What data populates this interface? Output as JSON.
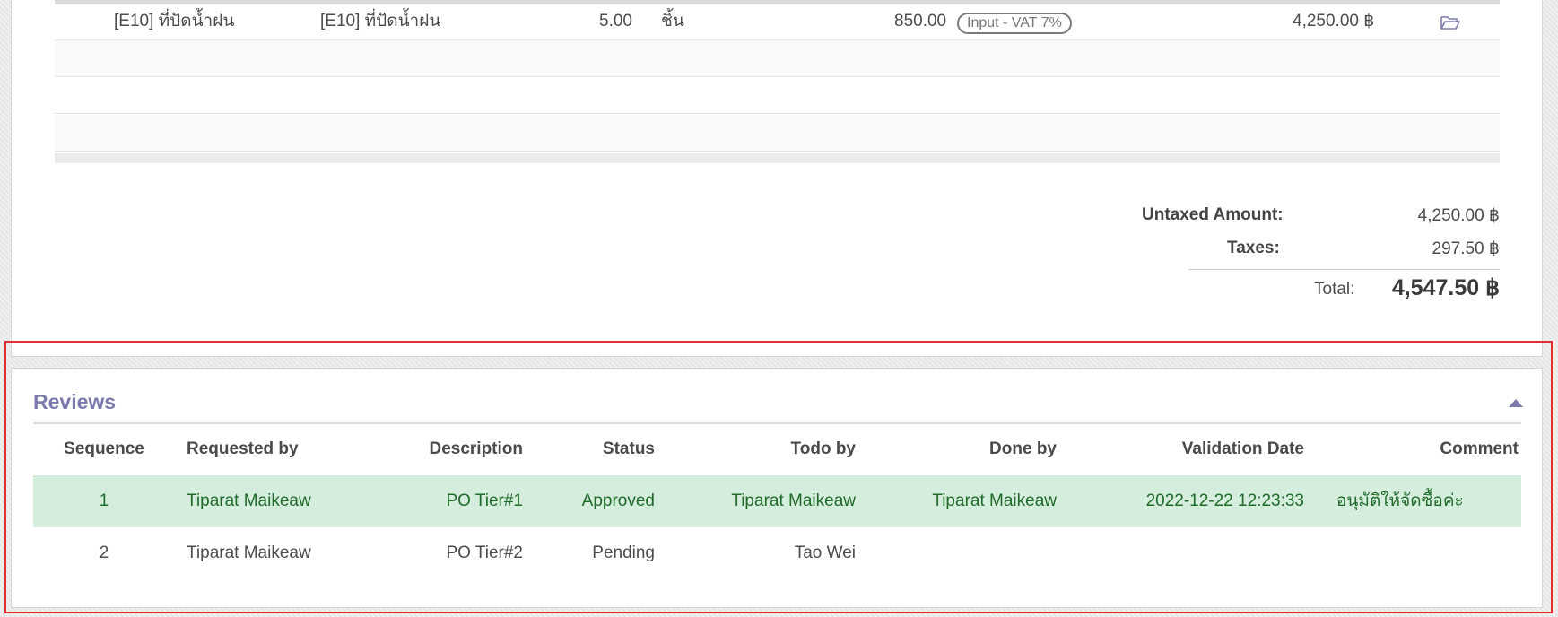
{
  "order_lines": [
    {
      "product": "[E10] ที่ปัดน้ำฝน",
      "description": "[E10] ที่ปัดน้ำฝน",
      "quantity": "5.00",
      "uom": "ชิ้น",
      "unit_price": "850.00",
      "tax": "Input - VAT 7%",
      "subtotal": "4,250.00 ฿"
    }
  ],
  "totals": {
    "untaxed_label": "Untaxed Amount:",
    "untaxed_value": "4,250.00 ฿",
    "taxes_label": "Taxes:",
    "taxes_value": "297.50 ฿",
    "total_label": "Total:",
    "total_value": "4,547.50 ฿"
  },
  "reviews": {
    "title": "Reviews",
    "columns": [
      "Sequence",
      "Requested by",
      "Description",
      "Status",
      "Todo by",
      "Done by",
      "Validation Date",
      "Comment"
    ],
    "rows": [
      {
        "sequence": "1",
        "requested_by": "Tiparat Maikeaw",
        "description": "PO Tier#1",
        "status": "Approved",
        "todo_by": "Tiparat Maikeaw",
        "done_by": "Tiparat Maikeaw",
        "validation_date": "2022-12-22 12:23:33",
        "comment": "อนุมัติให้จัดซื้อค่ะ"
      },
      {
        "sequence": "2",
        "requested_by": "Tiparat Maikeaw",
        "description": "PO Tier#2",
        "status": "Pending",
        "todo_by": "Tao Wei",
        "done_by": "",
        "validation_date": "",
        "comment": ""
      }
    ]
  },
  "colors": {
    "accent": "#7c7bad",
    "approved_row_bg": "#d5eddd",
    "approved_text": "#1e6b2a",
    "highlight_border": "#e03030"
  },
  "icons": {
    "line_action": "folder-open-icon",
    "collapse": "caret-up-icon"
  }
}
